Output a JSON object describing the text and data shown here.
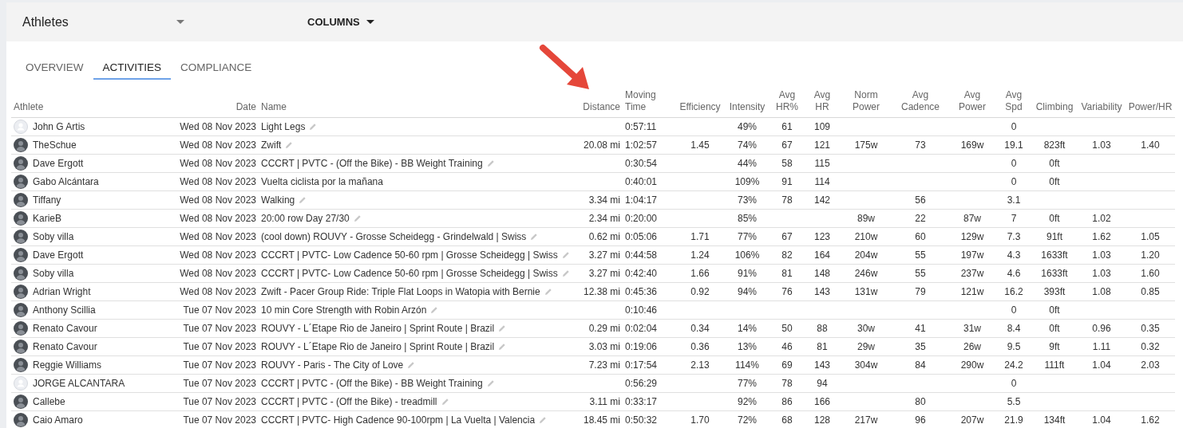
{
  "toolbar": {
    "view": "Athletes",
    "columns_menu": "COLUMNS"
  },
  "tabs": [
    {
      "label": "OVERVIEW",
      "selected": false
    },
    {
      "label": "ACTIVITIES",
      "selected": true
    },
    {
      "label": "COMPLIANCE",
      "selected": false
    }
  ],
  "table": {
    "columns": [
      "Athlete",
      "Date",
      "Name",
      "Distance",
      "Moving Time",
      "Efficiency",
      "Intensity",
      "Avg HR%",
      "Avg HR",
      "Norm Power",
      "Avg Cadence",
      "Avg Power",
      "Avg Spd",
      "Climbing",
      "Variability",
      "Power/HR"
    ],
    "rows": [
      {
        "kind": "placeholder",
        "athlete": "John G Artis",
        "date": "Wed 08 Nov 2023",
        "name": "Light Legs",
        "editable": true,
        "moving_time": "0:57:11",
        "intensity": "49%",
        "avg_hr_pct": "61",
        "avg_hr": "109",
        "avg_spd": "0"
      },
      {
        "kind": "photo",
        "athlete": "TheSchue",
        "date": "Wed 08 Nov 2023",
        "name": "Zwift",
        "editable": true,
        "distance": "20.08 mi",
        "moving_time": "1:02:57",
        "efficiency": "1.45",
        "intensity": "74%",
        "avg_hr_pct": "67",
        "avg_hr": "121",
        "norm_power": "175w",
        "avg_cadence": "73",
        "avg_power": "169w",
        "avg_spd": "19.1",
        "climbing": "823ft",
        "variability": "1.03",
        "power_hr": "1.40"
      },
      {
        "kind": "photo",
        "athlete": "Dave Ergott",
        "date": "Wed 08 Nov 2023",
        "name": "CCCRT | PVTC - (Off the Bike) - BB Weight Training",
        "editable": true,
        "moving_time": "0:30:54",
        "intensity": "44%",
        "avg_hr_pct": "58",
        "avg_hr": "115",
        "avg_spd": "0",
        "climbing": "0ft"
      },
      {
        "kind": "photo",
        "athlete": "Gabo Alcántara",
        "date": "Wed 08 Nov 2023",
        "name": "Vuelta ciclista por la mañana",
        "editable": false,
        "moving_time": "0:40:01",
        "intensity": "109%",
        "avg_hr_pct": "91",
        "avg_hr": "114",
        "avg_spd": "0",
        "climbing": "0ft"
      },
      {
        "kind": "photo",
        "athlete": "Tiffany",
        "date": "Wed 08 Nov 2023",
        "name": "Walking",
        "editable": true,
        "distance": "3.34 mi",
        "moving_time": "1:04:17",
        "intensity": "73%",
        "avg_hr_pct": "78",
        "avg_hr": "142",
        "avg_cadence": "56",
        "avg_spd": "3.1"
      },
      {
        "kind": "photo",
        "athlete": "KarieB",
        "date": "Wed 08 Nov 2023",
        "name": "20:00 row Day 27/30",
        "editable": true,
        "distance": "2.34 mi",
        "moving_time": "0:20:00",
        "intensity": "85%",
        "norm_power": "89w",
        "avg_cadence": "22",
        "avg_power": "87w",
        "avg_spd": "7",
        "climbing": "0ft",
        "variability": "1.02"
      },
      {
        "kind": "photo",
        "athlete": "Soby villa",
        "date": "Wed 08 Nov 2023",
        "name": "(cool down) ROUVY - Grosse Scheidegg - Grindelwald | Swiss",
        "editable": true,
        "distance": "0.62 mi",
        "moving_time": "0:05:06",
        "efficiency": "1.71",
        "intensity": "77%",
        "avg_hr_pct": "67",
        "avg_hr": "123",
        "norm_power": "210w",
        "avg_cadence": "60",
        "avg_power": "129w",
        "avg_spd": "7.3",
        "climbing": "91ft",
        "variability": "1.62",
        "power_hr": "1.05"
      },
      {
        "kind": "photo",
        "athlete": "Dave Ergott",
        "date": "Wed 08 Nov 2023",
        "name": "CCCRT | PVTC- Low Cadence 50-60 rpm | Grosse Scheidegg | Swiss",
        "editable": true,
        "distance": "3.27 mi",
        "moving_time": "0:44:58",
        "efficiency": "1.24",
        "intensity": "106%",
        "avg_hr_pct": "82",
        "avg_hr": "164",
        "norm_power": "204w",
        "avg_cadence": "55",
        "avg_power": "197w",
        "avg_spd": "4.3",
        "climbing": "1633ft",
        "variability": "1.03",
        "power_hr": "1.20"
      },
      {
        "kind": "photo",
        "athlete": "Soby villa",
        "date": "Wed 08 Nov 2023",
        "name": "CCCRT | PVTC- Low Cadence 50-60 rpm | Grosse Scheidegg | Swiss",
        "editable": true,
        "distance": "3.27 mi",
        "moving_time": "0:42:40",
        "efficiency": "1.66",
        "intensity": "91%",
        "avg_hr_pct": "81",
        "avg_hr": "148",
        "norm_power": "246w",
        "avg_cadence": "55",
        "avg_power": "237w",
        "avg_spd": "4.6",
        "climbing": "1633ft",
        "variability": "1.03",
        "power_hr": "1.60"
      },
      {
        "kind": "photo",
        "athlete": "Adrian Wright",
        "date": "Wed 08 Nov 2023",
        "name": "Zwift - Pacer Group Ride: Triple Flat Loops in Watopia with Bernie",
        "editable": true,
        "distance": "12.38 mi",
        "moving_time": "0:45:36",
        "efficiency": "0.92",
        "intensity": "94%",
        "avg_hr_pct": "76",
        "avg_hr": "143",
        "norm_power": "131w",
        "avg_cadence": "79",
        "avg_power": "121w",
        "avg_spd": "16.2",
        "climbing": "393ft",
        "variability": "1.08",
        "power_hr": "0.85"
      },
      {
        "kind": "photo",
        "athlete": "Anthony Scillia",
        "date": "Tue 07 Nov 2023",
        "name": "10 min Core Strength with Robin Arzón",
        "editable": true,
        "moving_time": "0:10:46",
        "avg_spd": "0",
        "climbing": "0ft"
      },
      {
        "kind": "photo",
        "athlete": "Renato Cavour",
        "date": "Tue 07 Nov 2023",
        "name": "ROUVY - L´Etape Rio de Janeiro | Sprint Route | Brazil",
        "editable": true,
        "distance": "0.29 mi",
        "moving_time": "0:02:04",
        "efficiency": "0.34",
        "intensity": "14%",
        "avg_hr_pct": "50",
        "avg_hr": "88",
        "norm_power": "30w",
        "avg_cadence": "41",
        "avg_power": "31w",
        "avg_spd": "8.4",
        "climbing": "0ft",
        "variability": "0.96",
        "power_hr": "0.35"
      },
      {
        "kind": "photo",
        "athlete": "Renato Cavour",
        "date": "Tue 07 Nov 2023",
        "name": "ROUVY - L´Etape Rio de Janeiro | Sprint Route | Brazil",
        "editable": true,
        "distance": "3.03 mi",
        "moving_time": "0:19:06",
        "efficiency": "0.36",
        "intensity": "13%",
        "avg_hr_pct": "46",
        "avg_hr": "81",
        "norm_power": "29w",
        "avg_cadence": "35",
        "avg_power": "26w",
        "avg_spd": "9.5",
        "climbing": "9ft",
        "variability": "1.11",
        "power_hr": "0.32"
      },
      {
        "kind": "photo",
        "athlete": "Reggie Williams",
        "date": "Tue 07 Nov 2023",
        "name": "ROUVY - Paris - The City of Love",
        "editable": true,
        "distance": "7.23 mi",
        "moving_time": "0:17:54",
        "efficiency": "2.13",
        "intensity": "114%",
        "avg_hr_pct": "69",
        "avg_hr": "143",
        "norm_power": "304w",
        "avg_cadence": "84",
        "avg_power": "290w",
        "avg_spd": "24.2",
        "climbing": "111ft",
        "variability": "1.04",
        "power_hr": "2.03"
      },
      {
        "kind": "placeholder",
        "athlete": "JORGE ALCANTARA",
        "date": "Tue 07 Nov 2023",
        "name": "CCCRT | PVTC - (Off the Bike) - BB Weight Training",
        "editable": true,
        "moving_time": "0:56:29",
        "intensity": "77%",
        "avg_hr_pct": "78",
        "avg_hr": "94",
        "avg_spd": "0"
      },
      {
        "kind": "photo",
        "athlete": "Callebe",
        "date": "Tue 07 Nov 2023",
        "name": "CCCRT | PVTC - (Off the Bike) - treadmill",
        "editable": true,
        "distance": "3.11 mi",
        "moving_time": "0:33:17",
        "intensity": "92%",
        "avg_hr_pct": "86",
        "avg_hr": "166",
        "avg_cadence": "80",
        "avg_spd": "5.5"
      },
      {
        "kind": "photo",
        "athlete": "Caio Amaro",
        "date": "Tue 07 Nov 2023",
        "name": "CCCRT | PVTC- High Cadence 90-100rpm | La Vuelta | Valencia",
        "editable": true,
        "distance": "18.45 mi",
        "moving_time": "0:50:32",
        "efficiency": "1.70",
        "intensity": "72%",
        "avg_hr_pct": "68",
        "avg_hr": "128",
        "norm_power": "217w",
        "avg_cadence": "96",
        "avg_power": "207w",
        "avg_spd": "21.9",
        "climbing": "134ft",
        "variability": "1.04",
        "power_hr": "1.62"
      }
    ]
  }
}
